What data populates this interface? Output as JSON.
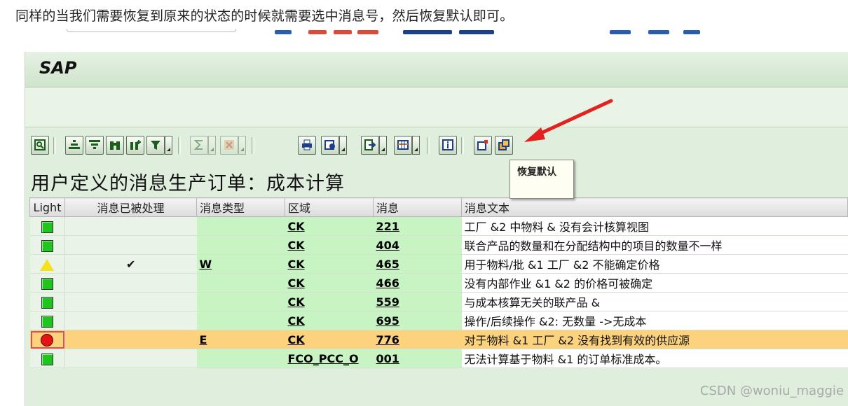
{
  "caption": "同样的当我们需要恢复到原来的状态的时候就需要选中消息号，然后恢复默认即可。",
  "sap": {
    "logo": "SAP",
    "tooltip": "恢复默认",
    "page_title": "用户定义的消息生产订单：成本计算",
    "columns": {
      "light": "Light",
      "processed": "消息已被处理",
      "msg_type": "消息类型",
      "area": "区域",
      "message": "消息",
      "text": "消息文本"
    },
    "rows": [
      {
        "status": "green",
        "processed": "",
        "msg_type": "",
        "area": "CK",
        "message": "221",
        "text": "工厂 &2 中物料 & 没有会计核算视图"
      },
      {
        "status": "green",
        "processed": "",
        "msg_type": "",
        "area": "CK",
        "message": "404",
        "text": "联合产品的数量和在分配结构中的项目的数量不一样"
      },
      {
        "status": "yellow",
        "processed": "✔",
        "msg_type": "W",
        "area": "CK",
        "message": "465",
        "text": "用于物料/批 &1 工厂 &2 不能确定价格"
      },
      {
        "status": "green",
        "processed": "",
        "msg_type": "",
        "area": "CK",
        "message": "466",
        "text": "没有内部作业 &1 &2 的价格可被确定"
      },
      {
        "status": "green",
        "processed": "",
        "msg_type": "",
        "area": "CK",
        "message": "559",
        "text": "与成本核算无关的联产品 &"
      },
      {
        "status": "green",
        "processed": "",
        "msg_type": "",
        "area": "CK",
        "message": "695",
        "text": "操作/后续操作 &2: 无数量 ->无成本"
      },
      {
        "status": "red",
        "processed": "",
        "msg_type": "E",
        "area": "CK",
        "message": "776",
        "text": "对于物料 &1 工厂 &2 没有找到有效的供应源"
      },
      {
        "status": "green",
        "processed": "",
        "msg_type": "",
        "area": "FCO_PCC_O",
        "message": "001",
        "text": "无法计算基于物料 &1 的订单标准成本。"
      }
    ]
  },
  "watermark": "CSDN @woniu_maggie",
  "colors": {
    "arrow": "#e5211f",
    "sap_bg": "#dfeedd",
    "key_cell": "#c8f4c4",
    "selected_row": "#fdd27d"
  }
}
